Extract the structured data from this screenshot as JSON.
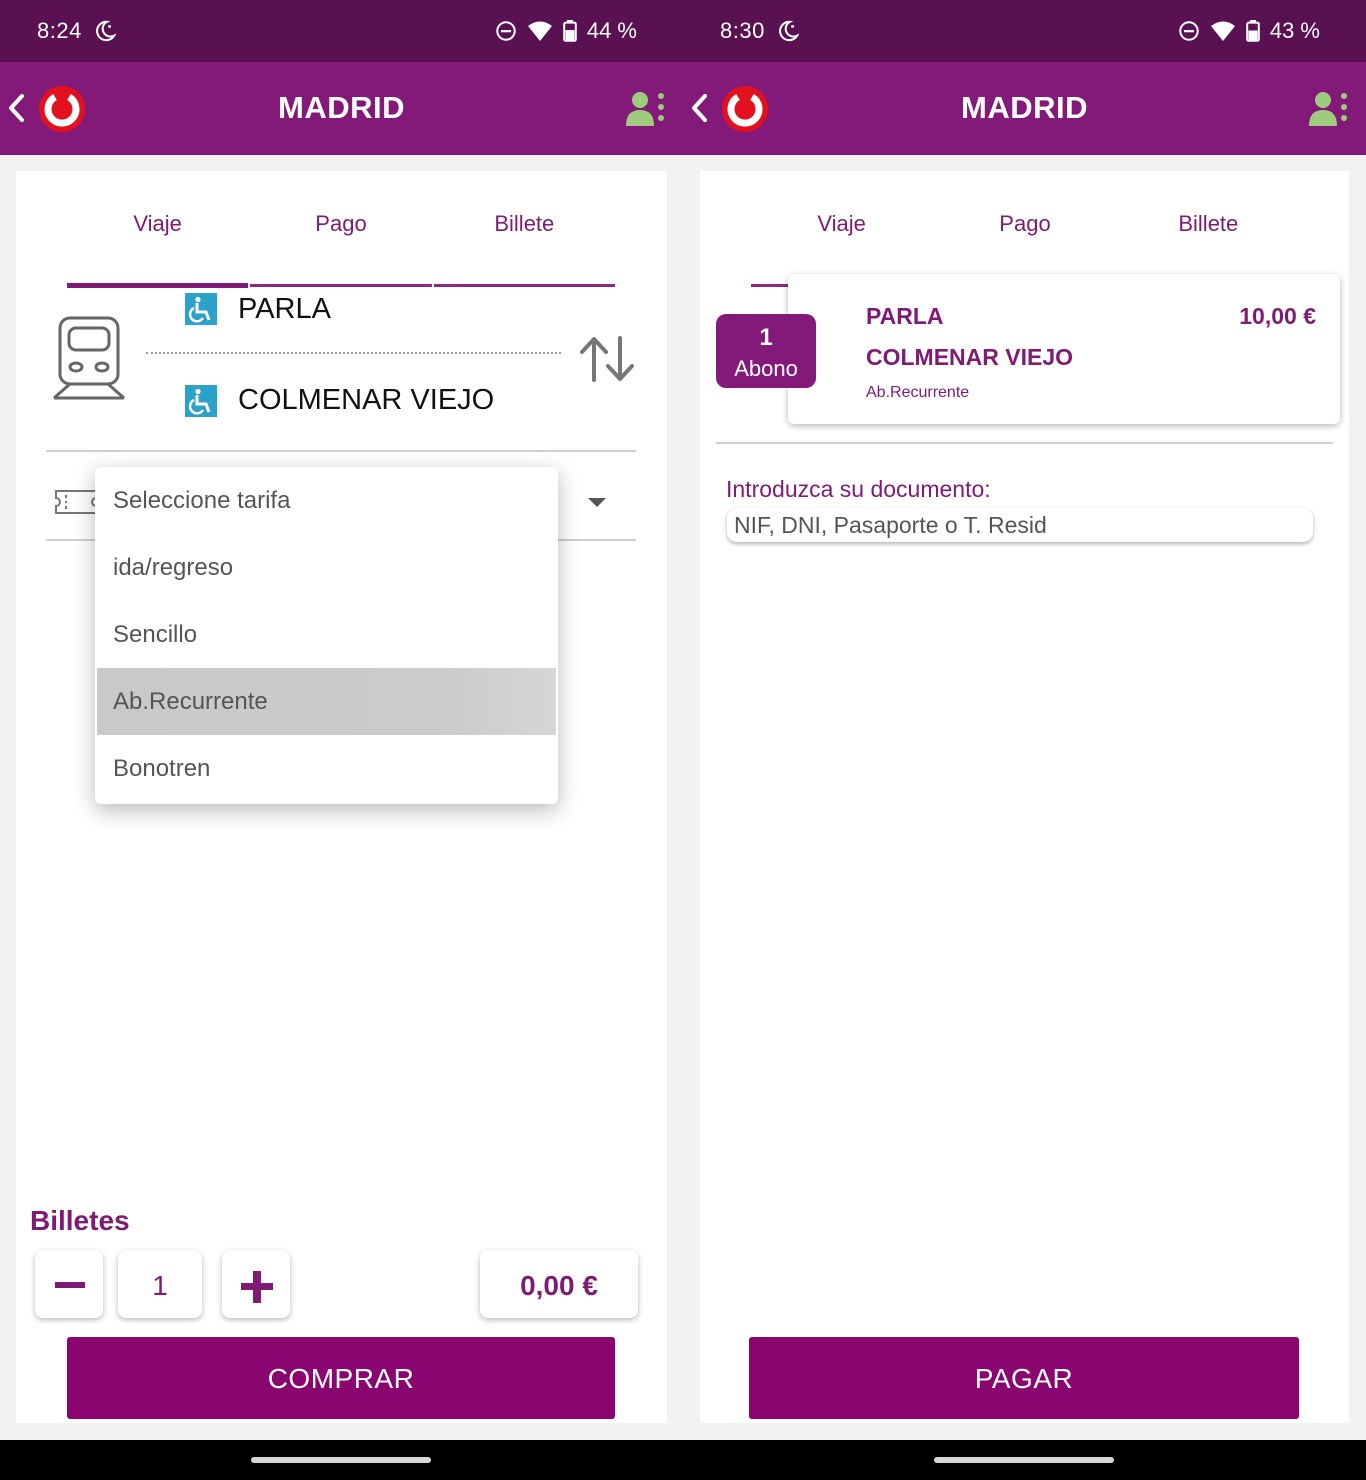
{
  "screens": [
    {
      "status": {
        "time": "8:24",
        "battery": "44 %"
      },
      "header": {
        "title": "MADRID"
      },
      "tabs": [
        {
          "label": "Viaje",
          "active": true
        },
        {
          "label": "Pago",
          "active": false
        },
        {
          "label": "Billete",
          "active": false
        }
      ],
      "trip": {
        "origin": "PARLA",
        "destination": "COLMENAR VIEJO"
      },
      "fare_dropdown": {
        "options": [
          "Seleccione tarifa",
          "ida/regreso",
          "Sencillo",
          "Ab.Recurrente",
          "Bonotren"
        ],
        "highlighted": "Ab.Recurrente"
      },
      "tickets": {
        "label": "Billetes",
        "quantity": "1",
        "total": "0,00 €"
      },
      "buy_button": "COMPRAR"
    },
    {
      "status": {
        "time": "8:30",
        "battery": "43 %"
      },
      "header": {
        "title": "MADRID"
      },
      "tabs": [
        {
          "label": "Viaje",
          "active": false
        },
        {
          "label": "Pago",
          "active": true
        },
        {
          "label": "Billete",
          "active": false
        }
      ],
      "summary": {
        "count": "1",
        "count_label": "Abono",
        "origin": "PARLA",
        "destination": "COLMENAR VIEJO",
        "fare": "Ab.Recurrente",
        "price": "10,00 €"
      },
      "document": {
        "label": "Introduzca su documento:",
        "placeholder": "NIF, DNI, Pasaporte o T. Resid"
      },
      "pay_button": "PAGAR"
    }
  ],
  "colors": {
    "status_bar": "#5a1152",
    "app_bar": "#831a79",
    "accent": "#7f1a75",
    "button": "#8a056f"
  }
}
